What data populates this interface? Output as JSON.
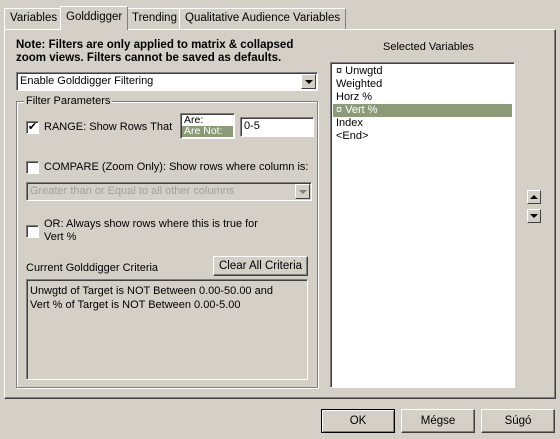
{
  "tabs": [
    {
      "label": "Variables",
      "active": false
    },
    {
      "label": "Golddigger",
      "active": true
    },
    {
      "label": "Trending",
      "active": false
    },
    {
      "label": "Qualitative Audience Variables",
      "active": false
    }
  ],
  "note": "Note: Filters are only applied to matrix & collapsed zoom views.  Filters cannot be saved as defaults.",
  "mode_select": {
    "value": "Enable Golddigger Filtering"
  },
  "filter_params": {
    "legend": "Filter Parameters",
    "range": {
      "checked": true,
      "label": "RANGE: Show Rows That",
      "options": [
        "Are:",
        "Are Not:"
      ],
      "selected": "Are Not:",
      "value": "0-5"
    },
    "compare": {
      "checked": false,
      "label": "COMPARE (Zoom Only): Show rows where column is:",
      "select_value": "Greater than or Equal to all other columns"
    },
    "or_option": {
      "checked": false,
      "label_line1": "OR: Always show rows where this is true for",
      "label_line2": "Vert %"
    },
    "criteria_label": "Current Golddigger Criteria",
    "clear_button": "Clear All Criteria",
    "criteria_text": "Unwgtd of Target is NOT Between 0.00-50.00 and\nVert % of Target is NOT Between 0.00-5.00"
  },
  "selected_variables": {
    "title": "Selected Variables",
    "items": [
      {
        "label": "¤ Unwgtd",
        "selected": false
      },
      {
        "label": "Weighted",
        "selected": false
      },
      {
        "label": "Horz %",
        "selected": false
      },
      {
        "label": "¤ Vert %",
        "selected": true
      },
      {
        "label": "Index",
        "selected": false
      },
      {
        "label": "<End>",
        "selected": false
      }
    ]
  },
  "footer": {
    "ok": "OK",
    "cancel": "Mégse",
    "help": "Súgó"
  },
  "colors": {
    "face": "#d4d0c8",
    "selection": "#8c9a78"
  }
}
